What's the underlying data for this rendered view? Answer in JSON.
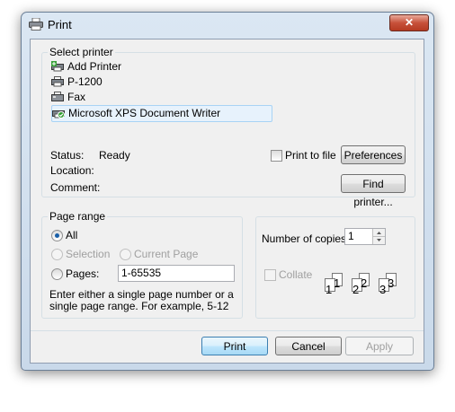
{
  "window": {
    "title": "Print",
    "close_glyph": "✕"
  },
  "select_printer": {
    "legend": "Select printer",
    "printers": [
      {
        "name": "Add Printer",
        "icon": "add-printer-icon"
      },
      {
        "name": "P-1200",
        "icon": "printer-icon"
      },
      {
        "name": "Fax",
        "icon": "fax-icon"
      },
      {
        "name": "Microsoft XPS Document Writer",
        "icon": "default-printer-icon",
        "selected": true
      }
    ],
    "status_label": "Status:",
    "status_value": "Ready",
    "location_label": "Location:",
    "location_value": "",
    "comment_label": "Comment:",
    "comment_value": "",
    "print_to_file_label": "Print to file",
    "print_to_file_checked": false,
    "preferences_button": "Preferences",
    "find_printer_button": "Find printer..."
  },
  "page_range": {
    "legend": "Page range",
    "all_label": "All",
    "selection_label": "Selection",
    "current_page_label": "Current Page",
    "pages_label": "Pages:",
    "pages_value": "1-65535",
    "selected_option": "All",
    "hint": "Enter either a single page number or a single page range.  For example, 5-12"
  },
  "copies": {
    "number_label": "Number of copies:",
    "number_value": "1",
    "collate_label": "Collate",
    "collate_checked": false,
    "collate_pages": [
      "1",
      "1",
      "2",
      "2",
      "3",
      "3"
    ]
  },
  "buttons": {
    "print": "Print",
    "cancel": "Cancel",
    "apply": "Apply"
  },
  "colors": {
    "accent": "#3c7fb1",
    "selection_bg": "#e7f2fc",
    "close_red": "#c7513a"
  }
}
